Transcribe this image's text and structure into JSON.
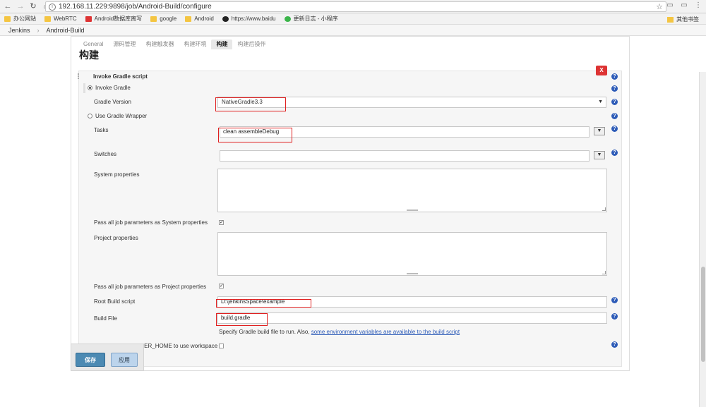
{
  "browser": {
    "url": "192.168.11.229:9898/job/Android-Build/configure",
    "bookmarks": [
      {
        "label": "办公网站",
        "icon": "folder-icon"
      },
      {
        "label": "WebRTC",
        "icon": "folder-icon"
      },
      {
        "label": "Android数据库离写",
        "icon": "red-app-icon"
      },
      {
        "label": "google",
        "icon": "folder-icon"
      },
      {
        "label": "Android",
        "icon": "folder-icon"
      },
      {
        "label": "https://www.baidu",
        "icon": "github-icon"
      },
      {
        "label": "更新日志 - 小程序",
        "icon": "wechat-icon"
      }
    ],
    "bookmarks_right": "其他书签"
  },
  "breadcrumb": {
    "root": "Jenkins",
    "sep": "›",
    "job": "Android-Build"
  },
  "tabs": [
    "General",
    "源码管理",
    "构建触发器",
    "构建环境",
    "构建",
    "构建后操作"
  ],
  "active_tab_index": 4,
  "section_title": "构建",
  "step": {
    "name": "Invoke Gradle script",
    "delete_label": "X",
    "invoke_gradle_label": "Invoke Gradle",
    "gradle_version_label": "Gradle Version",
    "gradle_version_value": "NativeGradle3.3",
    "use_wrapper_label": "Use Gradle Wrapper",
    "tasks_label": "Tasks",
    "tasks_value": "clean assembleDebug",
    "switches_label": "Switches",
    "switches_value": "",
    "system_props_label": "System properties",
    "pass_system_label": "Pass all job parameters as System properties",
    "project_props_label": "Project properties",
    "pass_project_label": "Pass all job parameters as Project properties",
    "root_build_label": "Root Build script",
    "root_build_value": "D:\\jenkinsSpace\\example",
    "build_file_label": "Build File",
    "build_file_value": "build.gradle",
    "build_file_hint_prefix": "Specify Gradle build file to run. Also, ",
    "build_file_hint_link": "some environment variables are available to the build script",
    "force_home_label": "Force GRADLE_USER_HOME to use workspace"
  },
  "buttons": {
    "save": "保存",
    "apply": "应用"
  },
  "colors": {
    "help": "#2e5cb8",
    "delete": "#dd3333",
    "save": "#4c8ab3",
    "annotation": "#e02020"
  }
}
